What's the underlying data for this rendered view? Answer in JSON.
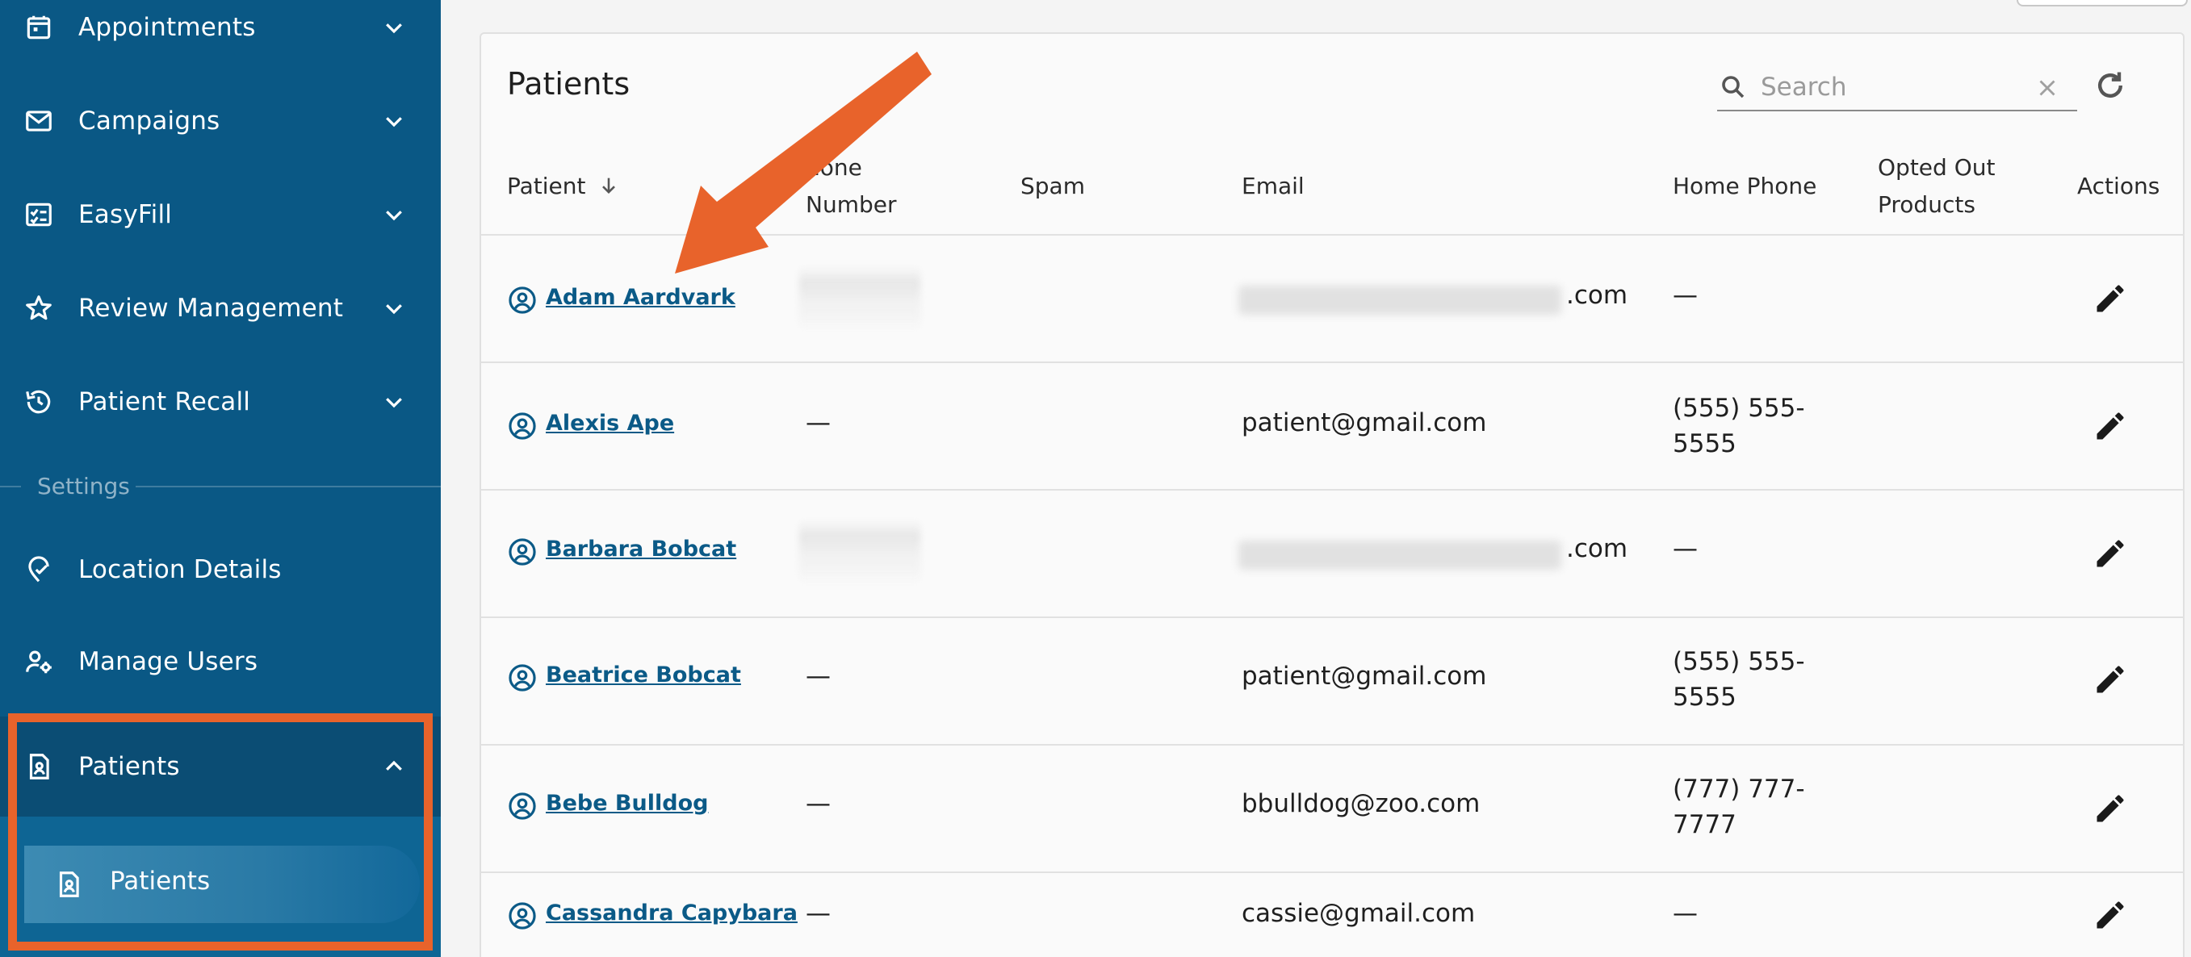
{
  "sidebar": {
    "nav": [
      {
        "label": "Appointments",
        "icon": "calendar-icon"
      },
      {
        "label": "Campaigns",
        "icon": "mail-icon"
      },
      {
        "label": "EasyFill",
        "icon": "checklist-icon"
      },
      {
        "label": "Review Management",
        "icon": "star-icon"
      },
      {
        "label": "Patient Recall",
        "icon": "history-icon"
      }
    ],
    "settings_label": "Settings",
    "settings": [
      {
        "label": "Location Details",
        "icon": "location-pin-icon"
      },
      {
        "label": "Manage Users",
        "icon": "manage-users-icon"
      }
    ],
    "patients_group": {
      "label": "Patients",
      "icon": "patient-file-icon"
    },
    "patients_sub": {
      "label": "Patients",
      "icon": "patient-file-icon"
    }
  },
  "main": {
    "title": "Patients",
    "search_placeholder": "Search",
    "columns": {
      "patient": "Patient",
      "phone_a": "hone",
      "phone_b": "Number",
      "spam": "Spam",
      "email": "Email",
      "home_phone": "Home Phone",
      "opted_a": "Opted Out",
      "opted_b": "Products",
      "actions": "Actions"
    },
    "rows": [
      {
        "name": "Adam Aardvark",
        "phone": "",
        "email": ".com",
        "home_phone": "—",
        "phone_blurred": true,
        "email_blurred": true
      },
      {
        "name": "Alexis Ape",
        "phone": "—",
        "email": "patient@gmail.com",
        "home_phone": "(555) 555-5555",
        "phone_blurred": false,
        "email_blurred": false
      },
      {
        "name": "Barbara Bobcat",
        "phone": "",
        "email": ".com",
        "home_phone": "—",
        "phone_blurred": true,
        "email_blurred": true
      },
      {
        "name": "Beatrice Bobcat",
        "phone": "—",
        "email": "patient@gmail.com",
        "home_phone": "(555) 555-5555",
        "phone_blurred": false,
        "email_blurred": false
      },
      {
        "name": "Bebe Bulldog",
        "phone": "—",
        "email": "bbulldog@zoo.com",
        "home_phone": "(777) 777-7777",
        "phone_blurred": false,
        "email_blurred": false
      },
      {
        "name": "Cassandra Capybara",
        "phone": "—",
        "email": "cassie@gmail.com",
        "home_phone": "—",
        "phone_blurred": false,
        "email_blurred": false
      }
    ]
  },
  "colors": {
    "sidebar": "#0a5885",
    "accent_orange": "#e8632b",
    "link": "#0b5a87"
  }
}
